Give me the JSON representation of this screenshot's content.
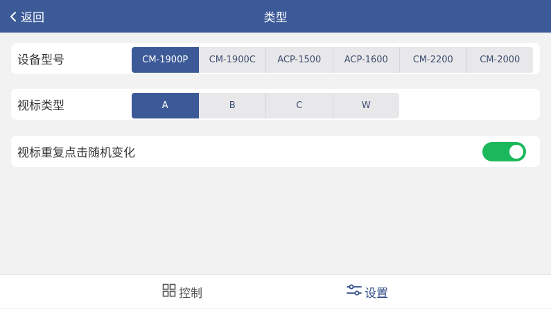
{
  "header": {
    "back_label": "返回",
    "title": "类型",
    "background": "#3d5a98",
    "back_icon": "chevron-left-icon"
  },
  "device_model": {
    "label": "设备型号",
    "options": [
      "CM-1900P",
      "CM-1900C",
      "ACP-1500",
      "ACP-1600",
      "CM-2200",
      "CM-2000"
    ],
    "selected": "CM-1900P"
  },
  "chart_type": {
    "label": "视标类型",
    "options": [
      "A",
      "B",
      "C",
      "W"
    ],
    "selected": "A"
  },
  "random_change": {
    "label": "视标重复点击随机变化",
    "enabled": true,
    "on_color": "#1ab85a"
  },
  "tabbar": {
    "control_label": "控制",
    "control_icon": "grid-icon",
    "settings_label": "设置",
    "settings_icon": "sliders-icon",
    "active_tab": "设置"
  }
}
